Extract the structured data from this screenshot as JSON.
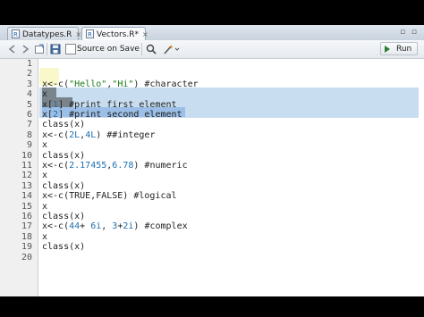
{
  "tabs": [
    {
      "label": "Datatypes.R",
      "close": "×"
    },
    {
      "label": "Vectors.R*",
      "close": "×"
    }
  ],
  "window_controls": "▫ ▫",
  "toolbar": {
    "source_on_save": "Source on Save",
    "run": "Run"
  },
  "editor": {
    "line_numbers": [
      "1",
      "2",
      "3",
      "4",
      "5",
      "6",
      "7",
      "8",
      "9",
      "10",
      "11",
      "12",
      "13",
      "14",
      "15",
      "16",
      "17",
      "18",
      "19",
      "20"
    ],
    "lines": [
      "",
      "",
      "x<-c(\"Hello\",\"Hi\") #character",
      "x",
      "x[1] #print first element",
      "x[2] #print second element",
      "class(x)",
      "x<-c(2L,4L) ##integer",
      "x",
      "class(x)",
      "x<-c(2.17455,6.78) #numeric",
      "x",
      "class(x)",
      "x<-c(TRUE,FALSE) #logical",
      "x",
      "class(x)",
      "x<-c(44+ 6i, 3+2i) #complex",
      "x",
      "class(x)",
      ""
    ]
  },
  "colors": {
    "line_highlight": "#c8ddf0",
    "number": "#1c6fb0",
    "string": "#1a7a1a",
    "run_arrow": "#2e7d32"
  }
}
